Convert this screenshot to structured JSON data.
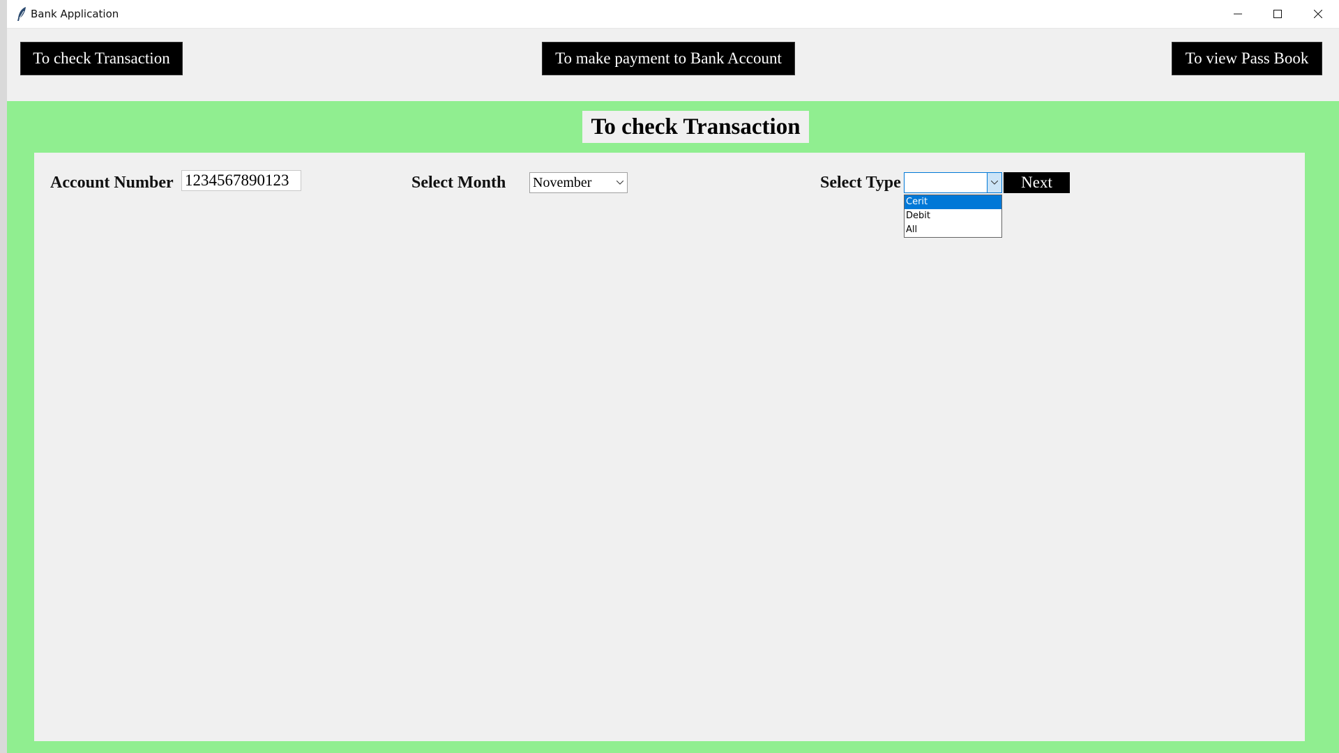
{
  "window": {
    "title": "Bank Application",
    "icons": {
      "app": "feather-icon",
      "minimize": "minimize-icon",
      "maximize": "maximize-icon",
      "close": "close-icon"
    }
  },
  "nav": {
    "check_transaction": "To check Transaction",
    "make_payment": "To make payment to Bank Account",
    "view_passbook": "To view Pass Book"
  },
  "section": {
    "heading": "To check Transaction",
    "background_color": "#90ee90"
  },
  "form": {
    "account_label": "Account Number",
    "account_value": "1234567890123",
    "month_label": "Select Month",
    "month_value": "November",
    "type_label": "Select Type",
    "type_value": "",
    "type_options": [
      "Cerit",
      "Debit",
      "All"
    ],
    "type_highlighted": "Cerit",
    "next_label": "Next"
  }
}
